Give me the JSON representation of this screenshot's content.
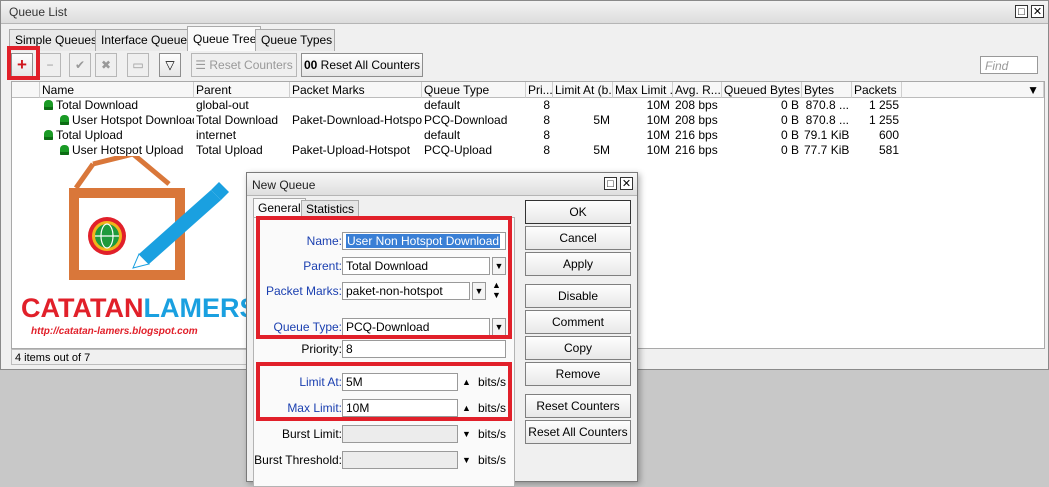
{
  "main_window": {
    "title": "Queue List",
    "tabs": [
      "Simple Queues",
      "Interface Queues",
      "Queue Tree",
      "Queue Types"
    ],
    "active_tab": "Queue Tree",
    "toolbar": {
      "reset_counters": "Reset Counters",
      "reset_all_counters": "Reset All Counters",
      "reset_all_prefix": "00"
    },
    "find_placeholder": "Find",
    "columns": [
      "Name",
      "Parent",
      "Packet Marks",
      "Queue Type",
      "Pri...",
      "Limit At (b...",
      "Max Limit ...",
      "Avg. R...",
      "Queued Bytes",
      "Bytes",
      "Packets"
    ],
    "rows": [
      {
        "name": "Total Download",
        "parent": "global-out",
        "packet_marks": "",
        "queue_type": "default",
        "priority": "8",
        "limit_at": "",
        "max_limit": "10M",
        "avg_rate": "208 bps",
        "queued_bytes": "0 B",
        "bytes": "870.8 ...",
        "packets": "1 255"
      },
      {
        "name": "User Hotspot Download",
        "parent": "Total Download",
        "packet_marks": "Paket-Download-Hotspot",
        "queue_type": "PCQ-Download",
        "priority": "8",
        "limit_at": "5M",
        "max_limit": "10M",
        "avg_rate": "208 bps",
        "queued_bytes": "0 B",
        "bytes": "870.8 ...",
        "packets": "1 255"
      },
      {
        "name": "Total Upload",
        "parent": "internet",
        "packet_marks": "",
        "queue_type": "default",
        "priority": "8",
        "limit_at": "",
        "max_limit": "10M",
        "avg_rate": "216 bps",
        "queued_bytes": "0 B",
        "bytes": "79.1 KiB",
        "packets": "600"
      },
      {
        "name": "User Hotspot Upload",
        "parent": "Total Upload",
        "packet_marks": "Paket-Upload-Hotspot",
        "queue_type": "PCQ-Upload",
        "priority": "8",
        "limit_at": "5M",
        "max_limit": "10M",
        "avg_rate": "216 bps",
        "queued_bytes": "0 B",
        "bytes": "77.7 KiB",
        "packets": "581"
      }
    ],
    "status": "4 items out of 7"
  },
  "logo": {
    "title": "CATATANLAMERS",
    "url": "http://catatan-lamers.blogspot.com"
  },
  "dialog": {
    "title": "New Queue",
    "tabs": [
      "General",
      "Statistics"
    ],
    "fields": {
      "name_label": "Name:",
      "name_value": "User Non Hotspot Download",
      "parent_label": "Parent:",
      "parent_value": "Total Download",
      "packet_marks_label": "Packet Marks:",
      "packet_marks_value": "paket-non-hotspot",
      "queue_type_label": "Queue Type:",
      "queue_type_value": "PCQ-Download",
      "priority_label": "Priority:",
      "priority_value": "8",
      "limit_at_label": "Limit At:",
      "limit_at_value": "5M",
      "max_limit_label": "Max Limit:",
      "max_limit_value": "10M",
      "burst_limit_label": "Burst Limit:",
      "burst_threshold_label": "Burst Threshold:",
      "unit": "bits/s"
    },
    "buttons": [
      "OK",
      "Cancel",
      "Apply",
      "Disable",
      "Comment",
      "Copy",
      "Remove",
      "Reset Counters",
      "Reset All Counters"
    ]
  },
  "colors": {
    "highlight": "#e1202a",
    "label_blue": "#1a3fb0",
    "logo_orange": "#d9773a",
    "logo_blue": "#1aa0e0"
  }
}
